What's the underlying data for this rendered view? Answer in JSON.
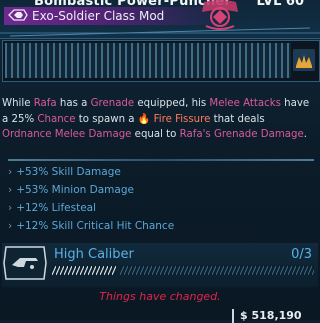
{
  "item": {
    "title": "Bombastic Power-Puncher",
    "level": "LVL 60",
    "class_mod_label": "Exo-Soldier Class Mod",
    "rarity_color": "#7a35a3"
  },
  "description": {
    "segments": [
      {
        "text": "While ",
        "style": "plain"
      },
      {
        "text": "Rafa",
        "style": "hl"
      },
      {
        "text": " has a ",
        "style": "plain"
      },
      {
        "text": "Grenade",
        "style": "hl"
      },
      {
        "text": " equipped, his ",
        "style": "plain"
      },
      {
        "text": "Melee Attacks",
        "style": "hl"
      },
      {
        "text": " have a 25% ",
        "style": "plain"
      },
      {
        "text": "Chance",
        "style": "hl"
      },
      {
        "text": " to spawn a ",
        "style": "plain"
      },
      {
        "text": "🔥 Fire Fissure",
        "style": "fire"
      },
      {
        "text": " that deals ",
        "style": "plain"
      },
      {
        "text": "Ordnance",
        "style": "hl"
      },
      {
        "text": " ",
        "style": "plain"
      },
      {
        "text": "Melee Damage",
        "style": "hl"
      },
      {
        "text": " equal to ",
        "style": "plain"
      },
      {
        "text": "Rafa's",
        "style": "hl"
      },
      {
        "text": " ",
        "style": "plain"
      },
      {
        "text": "Grenade Damage",
        "style": "hl"
      },
      {
        "text": ".",
        "style": "plain"
      }
    ]
  },
  "bonuses": [
    {
      "label": "+53% Skill Damage"
    },
    {
      "label": "+53% Minion Damage"
    },
    {
      "label": "+12% Lifesteal"
    },
    {
      "label": "+12% Skill Critical Hit Chance"
    }
  ],
  "skill": {
    "name": "High Caliber",
    "points": "0/3",
    "icon": "gun-skill-icon"
  },
  "notice": "Things have changed.",
  "footer": {
    "money": "$ 518,190",
    "money_icon": "dollar-icon"
  },
  "colors": {
    "accent_blue": "#5ab1e6",
    "highlight_pink": "#d95a9c",
    "fire": "#ff7d5c",
    "warning_red": "#e0254a"
  }
}
